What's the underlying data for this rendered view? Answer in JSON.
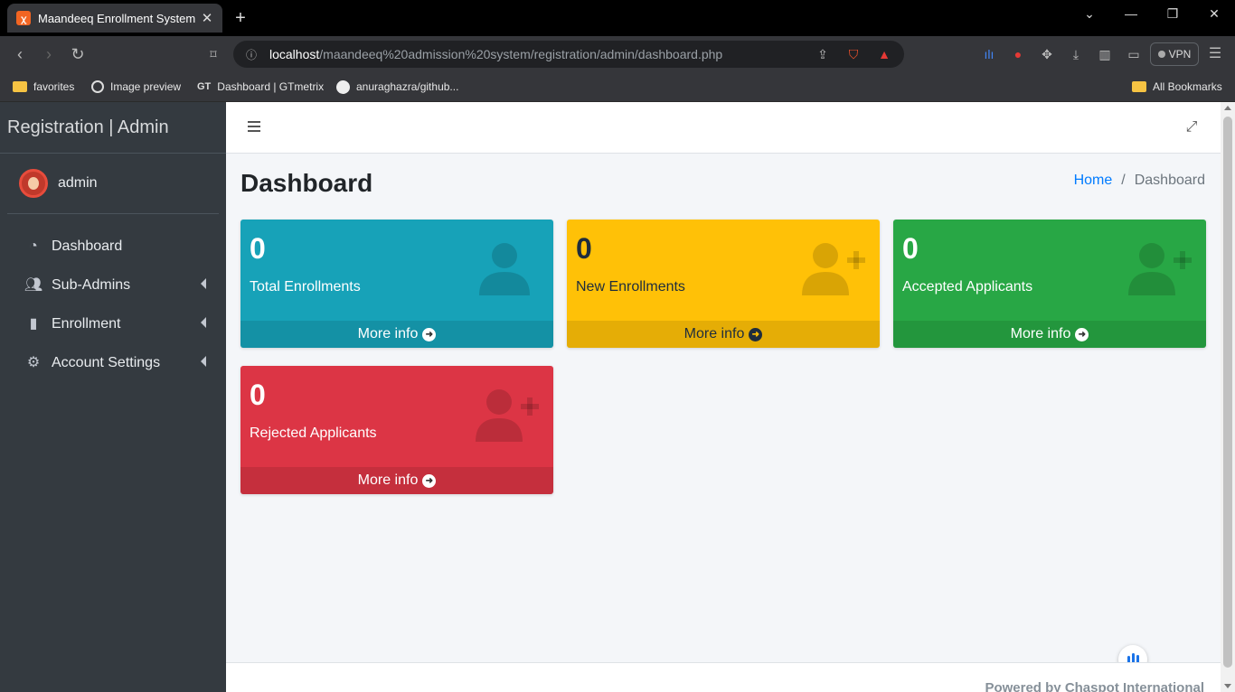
{
  "browser": {
    "tab_title": "Maandeeq Enrollment System | Dashboard",
    "url_host": "localhost",
    "url_path": "/maandeeq%20admission%20system/registration/admin/dashboard.php",
    "vpn_label": "VPN",
    "bookmarks": [
      "favorites",
      "Image preview",
      "Dashboard | GTmetrix",
      "anuraghazra/github..."
    ],
    "all_bookmarks": "All Bookmarks"
  },
  "sidebar": {
    "brand": "Registration | Admin",
    "user": "admin",
    "items": [
      {
        "label": "Dashboard",
        "icon": "tachometer-icon"
      },
      {
        "label": "Sub-Admins",
        "icon": "users-icon"
      },
      {
        "label": "Enrollment",
        "icon": "file-icon"
      },
      {
        "label": "Account Settings",
        "icon": "user-cog-icon"
      }
    ]
  },
  "header": {
    "title": "Dashboard",
    "breadcrumb": {
      "home": "Home",
      "separator": "/",
      "current": "Dashboard"
    }
  },
  "boxes": [
    {
      "count": "0",
      "label": "Total Enrollments",
      "footer": "More info",
      "color": "#17a2b8"
    },
    {
      "count": "0",
      "label": "New Enrollments",
      "footer": "More info",
      "color": "#ffc107"
    },
    {
      "count": "0",
      "label": "Accepted Applicants",
      "footer": "More info",
      "color": "#28a745"
    },
    {
      "count": "0",
      "label": "Rejected Applicants",
      "footer": "More info",
      "color": "#dc3545"
    }
  ],
  "footer": {
    "text": "Powered by Chaspot International"
  }
}
